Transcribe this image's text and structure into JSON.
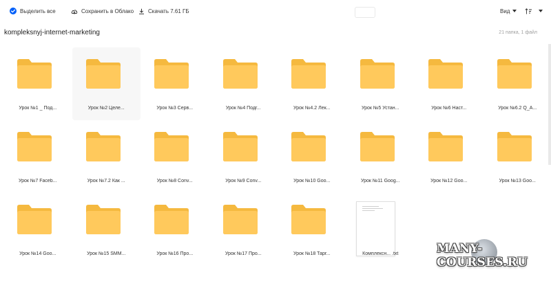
{
  "toolbar": {
    "select_all_label": "Выделить все",
    "save_label": "Сохранить в Облако",
    "download_label": "Скачать 7.61 ГБ",
    "view_label": "Вид",
    "sort_icon": "sort-icon",
    "accent_color": "#005ff9"
  },
  "folder": {
    "title": "kompleksnyj-internet-marketing",
    "counts": "21 папка, 1 файл"
  },
  "items": [
    {
      "name": "Урок №1 _ Под...",
      "type": "folder"
    },
    {
      "name": "Урок №2 Целе...",
      "type": "folder"
    },
    {
      "name": "Урок №3 Серв...",
      "type": "folder"
    },
    {
      "name": "Урок №4 Подг...",
      "type": "folder"
    },
    {
      "name": "Урок №4.2 Лек...",
      "type": "folder"
    },
    {
      "name": "Урок №5 Устан...",
      "type": "folder"
    },
    {
      "name": "Урок №6 Наст...",
      "type": "folder"
    },
    {
      "name": "Урок №6.2 Q_A...",
      "type": "folder"
    },
    {
      "name": "Урок №7 Faceb...",
      "type": "folder"
    },
    {
      "name": "Урок №7.2 Как ...",
      "type": "folder"
    },
    {
      "name": "Урок №8 Conv...",
      "type": "folder"
    },
    {
      "name": "Урок №9 Conv...",
      "type": "folder"
    },
    {
      "name": "Урок №10 Goo...",
      "type": "folder"
    },
    {
      "name": "Урок №11 Goog...",
      "type": "folder"
    },
    {
      "name": "Урок №12 Goo...",
      "type": "folder"
    },
    {
      "name": "Урок №13 Goo...",
      "type": "folder"
    },
    {
      "name": "Урок №14 Goo...",
      "type": "folder"
    },
    {
      "name": "Урок №15 SMM...",
      "type": "folder"
    },
    {
      "name": "Урок №16 Про...",
      "type": "folder"
    },
    {
      "name": "Урок №17 Про...",
      "type": "folder"
    },
    {
      "name": "Урок №18 Тарг...",
      "type": "folder"
    },
    {
      "name": "Комплексн... .txt",
      "type": "file"
    }
  ],
  "colors": {
    "folder": "#ffc95c",
    "folder_tab": "#f5b93f"
  },
  "watermark": {
    "text": "MANY-COURSES.RU"
  }
}
